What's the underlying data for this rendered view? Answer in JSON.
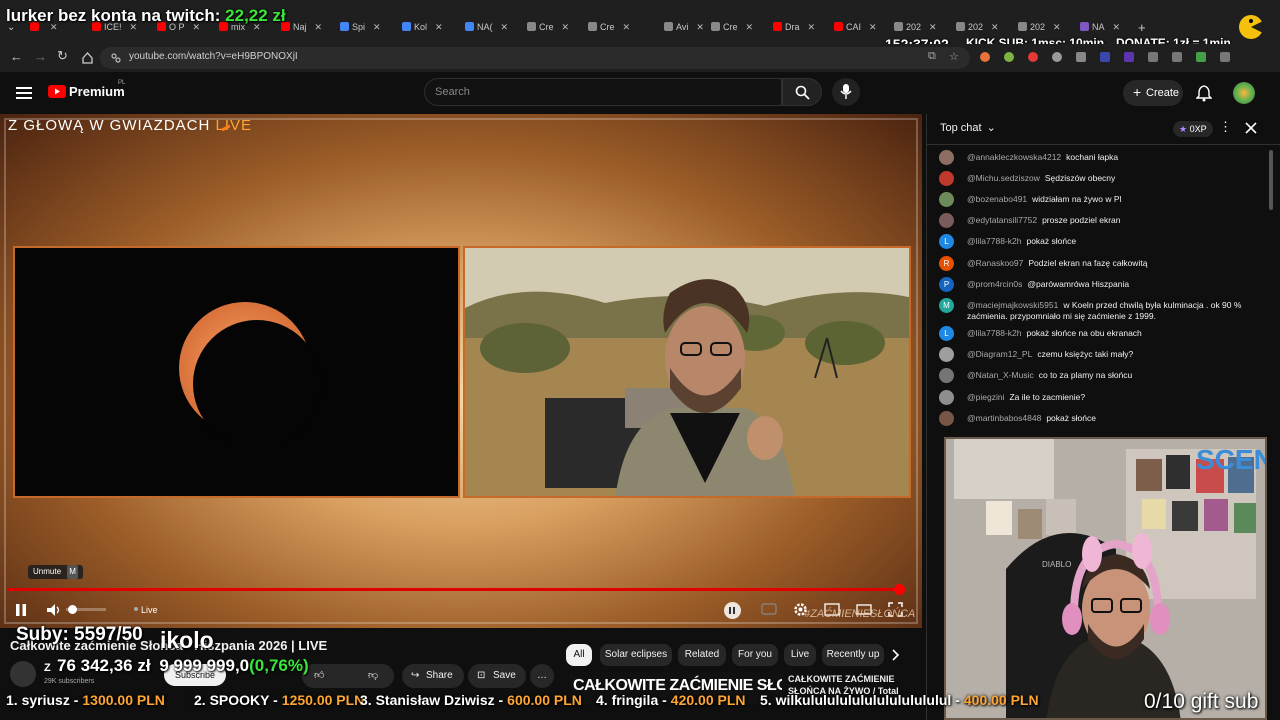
{
  "browser": {
    "tabs": [
      {
        "label": "",
        "color": "#ff0000"
      },
      {
        "label": "ICE!",
        "color": "#ff0000"
      },
      {
        "label": "O P",
        "color": "#ff0000"
      },
      {
        "label": "mix",
        "color": "#ff0000"
      },
      {
        "label": "Naj",
        "color": "#ff0000"
      },
      {
        "label": "Spi",
        "color": "#4285f4"
      },
      {
        "label": "Kol",
        "color": "#4285f4"
      },
      {
        "label": "NA(",
        "color": "#4285f4"
      },
      {
        "label": "Cre",
        "color": "#888888"
      },
      {
        "label": "Cre",
        "color": "#888888"
      },
      {
        "label": "Avi",
        "color": "#888888"
      },
      {
        "label": "Cre",
        "color": "#888888"
      },
      {
        "label": "Dra",
        "color": "#ff0000"
      },
      {
        "label": "CAI",
        "color": "#ff0000"
      },
      {
        "label": "202",
        "color": "#888888"
      },
      {
        "label": "202",
        "color": "#888888"
      },
      {
        "label": "202",
        "color": "#888888"
      },
      {
        "label": "NA",
        "color": "#7e57c2"
      }
    ],
    "tab_close": "✕",
    "new_tab": "+",
    "url": "youtube.com/watch?v=eH9BPONOXjI"
  },
  "overlay": {
    "lurker_label": "lurker bez konta na twitch:",
    "lurker_amount": "22,22 zł",
    "timer": "152:37:02",
    "kick_sub": "KICK SUB: 1msc: 10min",
    "donate": "DONATE: 1zł = 1min",
    "subs": "Suby: 5597/50",
    "total": "76 342,36 zł",
    "goal": "9 999 999,0",
    "goal_pct": "(0,76%)",
    "gift_sub": "0/10 gift sub"
  },
  "youtube": {
    "logo": "Premium",
    "logo_region": "PL",
    "search_placeholder": "Search",
    "create_label": "Create"
  },
  "video": {
    "banner": "Z GŁOWĄ W GWIAZDACH",
    "banner_live": "LIVE",
    "unmute_tooltip": "Unmute",
    "unmute_key": "M",
    "live_label": "Live",
    "watermark": "#ZAĆMIENIESŁOŃCA",
    "progress_fraction": 0.985
  },
  "below": {
    "title": "Całkowite zaćmienie Słońca - Hiszpania 2026 | LIVE",
    "ikolo": "ikolo",
    "channel_initial": "Z",
    "subscribers": "29K subscribers",
    "subscribe": "Subscribe",
    "share": "Share",
    "save": "Save",
    "more": "…",
    "chips": [
      "All",
      "Solar eclipses",
      "Related",
      "For you",
      "Live",
      "Recently up"
    ],
    "rec_title_big": "CAŁKOWITE ZAĆMIENIE SŁOŃCA",
    "rec_title_small": "CAŁKOWITE ZAĆMIENIE SŁOŃCA NA ŻYWO / Total"
  },
  "chat": {
    "header": "Top chat",
    "points": "0XP",
    "messages": [
      {
        "author": "@annakleczkowska4212",
        "text": "kochani łapka",
        "initial": "",
        "color": "#8d6e63"
      },
      {
        "author": "@Michu.sedziszow",
        "text": "Sędziszów obecny",
        "initial": "",
        "color": "#c0392b"
      },
      {
        "author": "@bozenabo491",
        "text": "widziałam na żywo w Pl",
        "initial": "",
        "color": "#6d8a5a"
      },
      {
        "author": "@edytatansili7752",
        "text": "prosze podziel ekran",
        "initial": "",
        "color": "#7a5c5c"
      },
      {
        "author": "@lila7788-k2h",
        "text": "pokaż słońce",
        "initial": "L",
        "color": "#1e88e5"
      },
      {
        "author": "@Ranaskoo97",
        "text": "Podziel ekran na fazę całkowitą",
        "initial": "R",
        "color": "#e65100"
      },
      {
        "author": "@prom4rcin0s",
        "text": "@parówamrówa Hiszpania",
        "initial": "P",
        "color": "#1565c0"
      },
      {
        "author": "@maciejmajkowski5951",
        "text": "w Koeln przed chwilą była kulminacja . ok 90 % zaćmienia. przypomniało mi się zaćmienie z 1999.",
        "initial": "M",
        "color": "#26a69a"
      },
      {
        "author": "@lila7788-k2h",
        "text": "pokaż słońce na obu ekranach",
        "initial": "L",
        "color": "#1e88e5"
      },
      {
        "author": "@Diagram12_PL",
        "text": "czemu księżyc taki mały?",
        "initial": "",
        "color": "#9e9e9e"
      },
      {
        "author": "@Natan_X-Music",
        "text": "co to za plamy na słońcu",
        "initial": "",
        "color": "#757575"
      },
      {
        "author": "@piegzini",
        "text": "Za ile to zacmienie?",
        "initial": "",
        "color": "#8e8e8e"
      },
      {
        "author": "@martinbabos4848",
        "text": "pokaż słońce",
        "initial": "",
        "color": "#795548"
      }
    ]
  },
  "ticker": [
    {
      "rank": "1. syriusz -",
      "amount": "1300.00 PLN"
    },
    {
      "rank": "2. SPOOKY -",
      "amount": "1250.00 PLN"
    },
    {
      "rank": "3. Stanisław Dziwisz -",
      "amount": "600.00 PLN"
    },
    {
      "rank": "4. fringila -",
      "amount": "420.00 PLN"
    },
    {
      "rank": "5. wilkulululululululululululul -",
      "amount": "400.00 PLN"
    }
  ],
  "icons": [
    "menu-icon",
    "search-icon",
    "mic-icon",
    "bell-icon",
    "close-icon",
    "pause-icon",
    "volume-icon",
    "settings-icon",
    "fullscreen-icon",
    "share-icon",
    "save-icon"
  ]
}
